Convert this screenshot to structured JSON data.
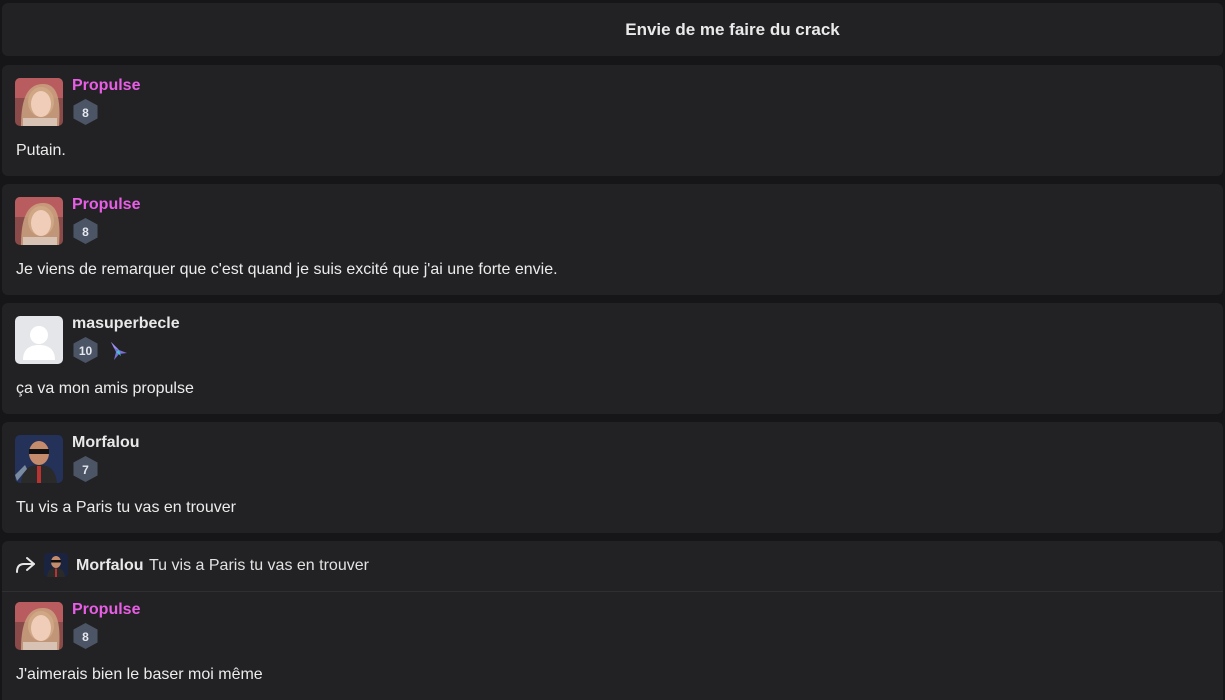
{
  "topic": {
    "title": "Envie de me faire du crack"
  },
  "posts": [
    {
      "username": "Propulse",
      "level": "8",
      "message": "Putain."
    },
    {
      "username": "Propulse",
      "level": "8",
      "message": "Je viens de remarquer que c'est quand je suis excité que j'ai une forte envie."
    },
    {
      "username": "masuperbecle",
      "level": "10",
      "message": "ça va mon amis propulse"
    },
    {
      "username": "Morfalou",
      "level": "7",
      "message": "Tu vis a Paris tu vas en trouver"
    },
    {
      "quote": {
        "username": "Morfalou",
        "text": "Tu vis a Paris tu vas en trouver"
      },
      "username": "Propulse",
      "level": "8",
      "message": "J'aimerais bien le baser moi même"
    }
  ],
  "colors": {
    "background": "#161618",
    "card": "#222224",
    "username_highlight": "#e85ee6",
    "level_badge": "#4c5566"
  },
  "icons": {
    "reply": "reply-arrow-icon",
    "badge": "hummingbird-icon"
  }
}
